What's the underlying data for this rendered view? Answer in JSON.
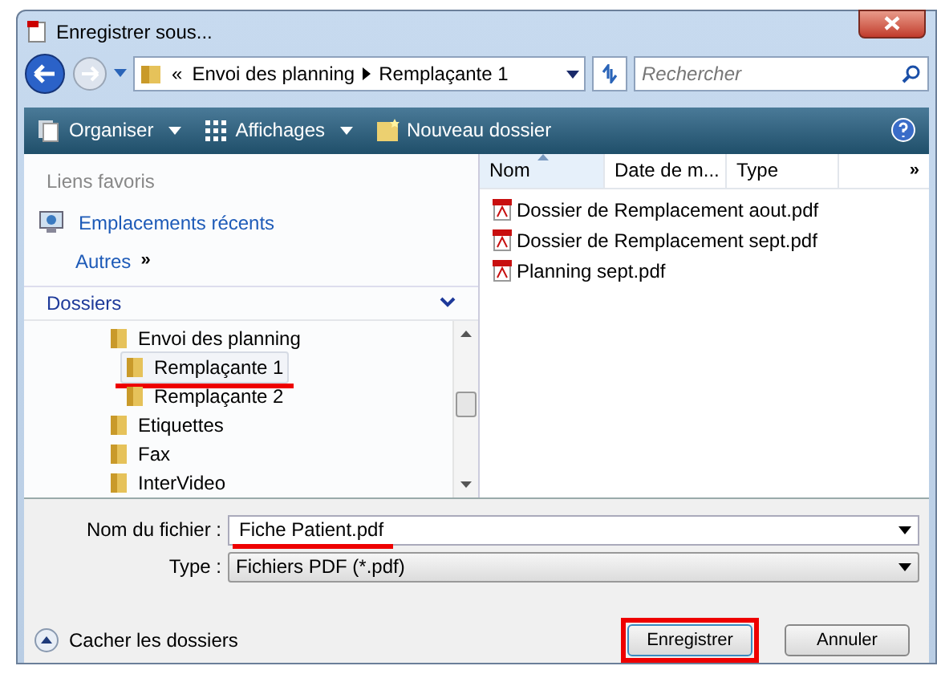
{
  "window": {
    "title": "Enregistrer sous..."
  },
  "address_bar": {
    "overflow": "«",
    "path": [
      "Envoi des planning",
      "Remplaçante 1"
    ]
  },
  "search": {
    "placeholder": "Rechercher"
  },
  "toolbar": [
    {
      "label": "Organiser",
      "kind": "menu"
    },
    {
      "label": "Affichages",
      "kind": "views"
    },
    {
      "label": "Nouveau dossier",
      "kind": "folder"
    }
  ],
  "sidebar": {
    "favorites_header": "Liens favoris",
    "favorites": [
      "Emplacements récents"
    ],
    "more": {
      "label": "Autres",
      "chevron": "»"
    },
    "folders_header": "Dossiers",
    "tree": [
      {
        "label": "Envoi des planning",
        "selected": false,
        "marked": false,
        "children": [
          {
            "label": "Remplaçante 1",
            "selected": true,
            "marked": true
          },
          {
            "label": "Remplaçante 2",
            "selected": false,
            "marked": false
          }
        ]
      },
      {
        "label": "Etiquettes",
        "selected": false,
        "marked": false
      },
      {
        "label": "Fax",
        "selected": false,
        "marked": false
      },
      {
        "label": "InterVideo",
        "selected": false,
        "marked": false
      }
    ]
  },
  "file_list": {
    "columns": [
      {
        "label": "Nom",
        "sorted": true
      },
      {
        "label": "Date de m...",
        "sorted": false
      },
      {
        "label": "Type",
        "sorted": false
      }
    ],
    "more_columns": "»",
    "files": [
      "Dossier de Remplacement aout.pdf",
      "Dossier de Remplacement sept.pdf",
      "Planning sept.pdf"
    ]
  },
  "filename": {
    "label": "Nom du fichier :",
    "value": "Fiche Patient.pdf",
    "marked": true
  },
  "file_type": {
    "label": "Type :",
    "value": "Fichiers PDF (*.pdf)"
  },
  "hide_folders": "Cacher les dossiers",
  "buttons": [
    {
      "label": "Enregistrer",
      "marked": true
    },
    {
      "label": "Annuler",
      "marked": false
    }
  ]
}
